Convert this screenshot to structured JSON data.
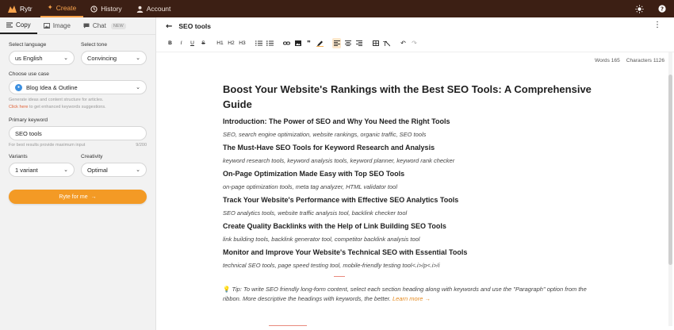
{
  "nav": {
    "brand": "Rytr",
    "items": [
      {
        "label": "Create",
        "icon": "sparkle-icon",
        "active": true
      },
      {
        "label": "History",
        "icon": "clock-icon",
        "active": false
      },
      {
        "label": "Account",
        "icon": "user-icon",
        "active": false
      }
    ],
    "accent": "#f7a24b",
    "bg": "#3c1f14"
  },
  "sidebar": {
    "tabs": [
      {
        "label": "Copy",
        "active": true
      },
      {
        "label": "Image",
        "active": false
      },
      {
        "label": "Chat",
        "badge": "NEW",
        "active": false
      }
    ],
    "language_label": "Select language",
    "language_value": "us English",
    "tone_label": "Select tone",
    "tone_value": "Convincing",
    "usecase_label": "Choose use case",
    "usecase_value": "Blog Idea & Outline",
    "usecase_hint": "Generate ideas and content structure for articles.",
    "usecase_link": "Click here",
    "usecase_link_rest": " to get enhanced keywords suggestions.",
    "keyword_label": "Primary keyword",
    "keyword_value": "SEO tools",
    "keyword_hint": "For best results provide maximum input",
    "keyword_counter": "9/200",
    "variants_label": "Variants",
    "variants_value": "1 variant",
    "creativity_label": "Creativity",
    "creativity_value": "Optimal",
    "cta_label": "Ryte for me",
    "cta_arrow": "→"
  },
  "editor": {
    "doc_title": "SEO tools",
    "toolbar": [
      "B",
      "I",
      "U",
      "S",
      "H1",
      "H2",
      "H3"
    ],
    "words": "Words 165",
    "characters": "Characters 1126",
    "title": "Boost Your Website's Rankings with the Best SEO Tools: A Comprehensive Guide",
    "sections": [
      {
        "heading": "Introduction: The Power of SEO and Why You Need the Right Tools",
        "keywords": "SEO, search engine optimization, website rankings, organic traffic, SEO tools"
      },
      {
        "heading": "The Must-Have SEO Tools for Keyword Research and Analysis",
        "keywords": "keyword research tools, keyword analysis tools, keyword planner, keyword rank checker"
      },
      {
        "heading": "On-Page Optimization Made Easy with Top SEO Tools",
        "keywords": "on-page optimization tools, meta tag analyzer, HTML validator tool"
      },
      {
        "heading": "Track Your Website's Performance with Effective SEO Analytics Tools",
        "keywords": "SEO analytics tools, website traffic analysis tool, backlink checker tool"
      },
      {
        "heading": "Create Quality Backlinks with the Help of Link Building SEO Tools",
        "keywords": "link building tools, backlink generator tool, competitor backlink analysis tool"
      },
      {
        "heading": "Monitor and Improve Your Website's Technical SEO with Essential Tools",
        "keywords": "technical SEO tools, page speed testing tool, mobile-friendly testing tool<.i>/p<.i>/i"
      }
    ],
    "tip": "Tip: To write SEO friendly long-form content, select each section heading along with keywords and use the \"Paragraph\" option from the ribbon. More descriptive the headings with keywords, the better.",
    "tip_link": "Learn more →"
  }
}
